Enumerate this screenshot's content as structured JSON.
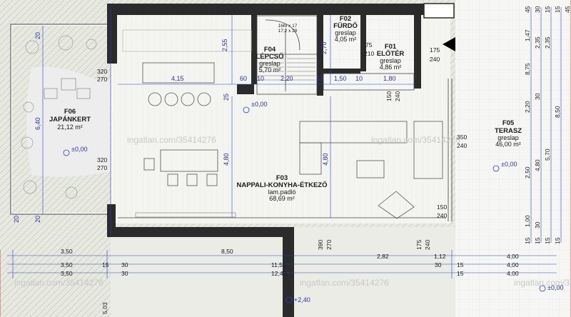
{
  "rooms": {
    "f01": {
      "code": "F01",
      "name": "ELŐTÉR",
      "floor": "greslap",
      "area": "4,86 m²"
    },
    "f02": {
      "code": "F02",
      "name": "FÜRDŐ",
      "floor": "greslap",
      "area": "4,05 m²"
    },
    "f03": {
      "code": "F03",
      "name": "NAPPALI-KONYHA-ÉTKEZŐ",
      "floor": "lam.padló",
      "area": "68,69 m²"
    },
    "f04": {
      "code": "F04",
      "name": "LÉPCSŐ",
      "floor": "greslap",
      "area": "5,70 m²"
    },
    "f05": {
      "code": "F05",
      "name": "TERASZ",
      "floor": "greslap",
      "area": "46,00 m²"
    },
    "f06": {
      "code": "F06",
      "name": "JAPÁNKERT",
      "area": "21,12 m²"
    }
  },
  "levels": {
    "living": "±0,00",
    "garden": "±0,00",
    "terrace": "±0,00",
    "corner": "±0,00",
    "outside": "+2,40"
  },
  "watermark": "ingatlan.com/35414276",
  "stair_note": {
    "line1": "16M x 17",
    "line2": "17,2 x 28"
  },
  "dims": {
    "d1": "4,15",
    "d2": "60",
    "d3": "10",
    "d4": "2,20",
    "d5": "10",
    "d6": "1,50",
    "d7": "10",
    "d8": "1,80",
    "d9": "2,55",
    "d10": "2,70",
    "d11": "25",
    "d12": "4,80",
    "d13": "4,80",
    "d14": "6,40",
    "d15": "320",
    "d16": "270",
    "d17": "320",
    "d18": "270",
    "d19": "20",
    "d20": "20",
    "d21": "20",
    "d22": "175",
    "d23": "240",
    "d24": "75",
    "d25": "210",
    "d26": "150",
    "d27": "240",
    "d28": "150",
    "d29": "240",
    "d30": "350",
    "d31": "240",
    "d32": "150",
    "d33": "240",
    "d34": "390",
    "d35": "270",
    "d36": "175",
    "d37": "240"
  },
  "bottom_dims": {
    "r1": [
      "3,50",
      "8,50",
      "2,82",
      "1,12",
      "4,00"
    ],
    "r2": [
      "3,50",
      "15",
      "30",
      "11,55",
      "30",
      "15",
      "4,00"
    ],
    "r3": [
      "3,50",
      "30",
      "12,45",
      "15",
      "4,00"
    ],
    "r4": [
      "5,03"
    ]
  },
  "right_dims": {
    "c1": [
      "45",
      "1,47",
      "8,75",
      "2,20",
      "2,50",
      "1,00",
      "15"
    ],
    "c2": [
      "30",
      "2,35",
      "30",
      "4,80",
      "30",
      "15"
    ],
    "c3": [
      "15",
      "2,35",
      "5,70",
      "15"
    ],
    "c4": [
      "15",
      "8,50",
      "15"
    ],
    "c5": [
      "45"
    ]
  }
}
